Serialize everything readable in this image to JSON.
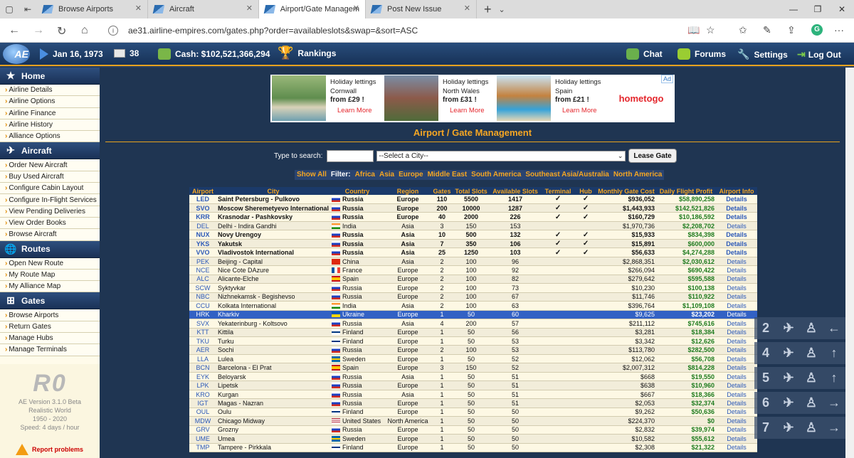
{
  "browser": {
    "tabs": [
      {
        "label": "Browse Airports"
      },
      {
        "label": "Aircraft"
      },
      {
        "label": "Airport/Gate Managem"
      },
      {
        "label": "Post New Issue"
      }
    ],
    "url": "ae31.airline-empires.com/gates.php?order=availableslots&swap=&sort=ASC"
  },
  "header": {
    "date": "Jan 16, 1973",
    "messages": "38",
    "cash": "Cash: $102,521,366,294",
    "rankings": "Rankings",
    "chat": "Chat",
    "forums": "Forums",
    "settings": "Settings",
    "logout": "Log Out",
    "logo": "AE"
  },
  "sidebar": {
    "sections": [
      {
        "title": "Home",
        "items": [
          "Airline Details",
          "Airline Options",
          "Airline Finance",
          "Airline History",
          "Alliance Options"
        ]
      },
      {
        "title": "Aircraft",
        "items": [
          "Order New Aircraft",
          "Buy Used Aircraft",
          "Configure Cabin Layout",
          "Configure In-Flight Services",
          "View Pending Deliveries",
          "View Order Books",
          "Browse Aircraft"
        ]
      },
      {
        "title": "Routes",
        "items": [
          "Open New Route",
          "My Route Map",
          "My Alliance Map"
        ]
      },
      {
        "title": "Gates",
        "items": [
          "Browse Airports",
          "Return Gates",
          "Manage Hubs",
          "Manage Terminals"
        ]
      }
    ],
    "footer": {
      "logo": "R0",
      "version": "AE Version 3.1.0 Beta",
      "world": "Realistic World",
      "years": "1950 - 2020",
      "speed": "Speed: 4 days / hour",
      "report": "Report problems"
    }
  },
  "ad": {
    "cards": [
      {
        "line1": "Holiday lettings",
        "line2": "Cornwall",
        "price": "from £29 !",
        "more": "Learn More"
      },
      {
        "line1": "Holiday lettings",
        "line2": "North Wales",
        "price": "from £31 !",
        "more": "Learn More"
      },
      {
        "line1": "Holiday lettings",
        "line2": "Spain",
        "price": "from £21 !",
        "more": "Learn More"
      }
    ],
    "brand": "hometogo",
    "tag": "Ad"
  },
  "page": {
    "title": "Airport / Gate Management",
    "search_label": "Type to search:",
    "city_select": "--Select a City--",
    "lease_button": "Lease Gate",
    "filter_show_all": "Show All",
    "filter_label": "Filter:",
    "filters": [
      "Africa",
      "Asia",
      "Europe",
      "Middle East",
      "South America",
      "Southeast Asia/Australia",
      "North America"
    ]
  },
  "table": {
    "headers": [
      "Airport",
      "City",
      "Country",
      "Region",
      "Gates",
      "Total Slots",
      "Available Slots",
      "Terminal",
      "Hub",
      "Monthly Gate Cost",
      "Daily Flight Profit",
      "Airport Info"
    ],
    "rows": [
      {
        "code": "LED",
        "city": "Saint Petersburg - Pulkovo",
        "country": "Russia",
        "flag": "ru",
        "region": "Europe",
        "gates": "110",
        "total": "5500",
        "avail": "1417",
        "terminal": "✓",
        "hub": "✓",
        "cost": "$936,052",
        "profit": "$58,890,258",
        "info": "Details",
        "bold": true
      },
      {
        "code": "SVO",
        "city": "Moscow Sheremetyevo International",
        "country": "Russia",
        "flag": "ru",
        "region": "Europe",
        "gates": "200",
        "total": "10000",
        "avail": "1287",
        "terminal": "✓",
        "hub": "✓",
        "cost": "$1,443,933",
        "profit": "$142,521,826",
        "info": "Details",
        "bold": true
      },
      {
        "code": "KRR",
        "city": "Krasnodar - Pashkovsky",
        "country": "Russia",
        "flag": "ru",
        "region": "Europe",
        "gates": "40",
        "total": "2000",
        "avail": "226",
        "terminal": "✓",
        "hub": "✓",
        "cost": "$160,729",
        "profit": "$10,186,592",
        "info": "Details",
        "bold": true
      },
      {
        "code": "DEL",
        "city": "Delhi - Indira Gandhi",
        "country": "India",
        "flag": "in",
        "region": "Asia",
        "gates": "3",
        "total": "150",
        "avail": "153",
        "terminal": "",
        "hub": "",
        "cost": "$1,970,736",
        "profit": "$2,208,702",
        "info": "Details"
      },
      {
        "code": "NUX",
        "city": "Novy Urengoy",
        "country": "Russia",
        "flag": "ru",
        "region": "Asia",
        "gates": "10",
        "total": "500",
        "avail": "132",
        "terminal": "✓",
        "hub": "✓",
        "cost": "$15,933",
        "profit": "$834,398",
        "info": "Details",
        "bold": true
      },
      {
        "code": "YKS",
        "city": "Yakutsk",
        "country": "Russia",
        "flag": "ru",
        "region": "Asia",
        "gates": "7",
        "total": "350",
        "avail": "106",
        "terminal": "✓",
        "hub": "✓",
        "cost": "$15,891",
        "profit": "$600,000",
        "info": "Details",
        "bold": true
      },
      {
        "code": "VVO",
        "city": "Vladivostok International",
        "country": "Russia",
        "flag": "ru",
        "region": "Asia",
        "gates": "25",
        "total": "1250",
        "avail": "103",
        "terminal": "✓",
        "hub": "✓",
        "cost": "$56,633",
        "profit": "$4,274,288",
        "info": "Details",
        "bold": true
      },
      {
        "code": "PEK",
        "city": "Beijing - Capital",
        "country": "China",
        "flag": "cn",
        "region": "Asia",
        "gates": "2",
        "total": "100",
        "avail": "96",
        "terminal": "",
        "hub": "",
        "cost": "$2,868,351",
        "profit": "$2,030,612",
        "info": "Details"
      },
      {
        "code": "NCE",
        "city": "Nice Cote DAzure",
        "country": "France",
        "flag": "fr",
        "region": "Europe",
        "gates": "2",
        "total": "100",
        "avail": "92",
        "terminal": "",
        "hub": "",
        "cost": "$266,094",
        "profit": "$690,422",
        "info": "Details"
      },
      {
        "code": "ALC",
        "city": "Alicante-Elche",
        "country": "Spain",
        "flag": "es",
        "region": "Europe",
        "gates": "2",
        "total": "100",
        "avail": "82",
        "terminal": "",
        "hub": "",
        "cost": "$279,642",
        "profit": "$595,588",
        "info": "Details"
      },
      {
        "code": "SCW",
        "city": "Syktyvkar",
        "country": "Russia",
        "flag": "ru",
        "region": "Europe",
        "gates": "2",
        "total": "100",
        "avail": "73",
        "terminal": "",
        "hub": "",
        "cost": "$10,230",
        "profit": "$100,138",
        "info": "Details"
      },
      {
        "code": "NBC",
        "city": "Nizhnekamsk - Begishevso",
        "country": "Russia",
        "flag": "ru",
        "region": "Europe",
        "gates": "2",
        "total": "100",
        "avail": "67",
        "terminal": "",
        "hub": "",
        "cost": "$11,746",
        "profit": "$110,922",
        "info": "Details"
      },
      {
        "code": "CCU",
        "city": "Kolkata International",
        "country": "India",
        "flag": "in",
        "region": "Asia",
        "gates": "2",
        "total": "100",
        "avail": "63",
        "terminal": "",
        "hub": "",
        "cost": "$396,764",
        "profit": "$1,109,108",
        "info": "Details"
      },
      {
        "code": "HRK",
        "city": "Kharkiv",
        "country": "Ukraine",
        "flag": "ua",
        "region": "Europe",
        "gates": "1",
        "total": "50",
        "avail": "60",
        "terminal": "",
        "hub": "",
        "cost": "$9,625",
        "profit": "$23,202",
        "info": "Details",
        "selected": true
      },
      {
        "code": "SVX",
        "city": "Yekaterinburg - Koltsovo",
        "country": "Russia",
        "flag": "ru",
        "region": "Asia",
        "gates": "4",
        "total": "200",
        "avail": "57",
        "terminal": "",
        "hub": "",
        "cost": "$211,112",
        "profit": "$745,616",
        "info": "Details"
      },
      {
        "code": "KTT",
        "city": "Kittila",
        "country": "Finland",
        "flag": "fi",
        "region": "Europe",
        "gates": "1",
        "total": "50",
        "avail": "56",
        "terminal": "",
        "hub": "",
        "cost": "$3,281",
        "profit": "$18,384",
        "info": "Details"
      },
      {
        "code": "TKU",
        "city": "Turku",
        "country": "Finland",
        "flag": "fi",
        "region": "Europe",
        "gates": "1",
        "total": "50",
        "avail": "53",
        "terminal": "",
        "hub": "",
        "cost": "$3,342",
        "profit": "$12,626",
        "info": "Details"
      },
      {
        "code": "AER",
        "city": "Sochi",
        "country": "Russia",
        "flag": "ru",
        "region": "Europe",
        "gates": "2",
        "total": "100",
        "avail": "53",
        "terminal": "",
        "hub": "",
        "cost": "$113,780",
        "profit": "$282,500",
        "info": "Details"
      },
      {
        "code": "LLA",
        "city": "Lulea",
        "country": "Sweden",
        "flag": "se",
        "region": "Europe",
        "gates": "1",
        "total": "50",
        "avail": "52",
        "terminal": "",
        "hub": "",
        "cost": "$12,062",
        "profit": "$56,708",
        "info": "Details"
      },
      {
        "code": "BCN",
        "city": "Barcelona - El Prat",
        "country": "Spain",
        "flag": "es",
        "region": "Europe",
        "gates": "3",
        "total": "150",
        "avail": "52",
        "terminal": "",
        "hub": "",
        "cost": "$2,007,312",
        "profit": "$814,228",
        "info": "Details"
      },
      {
        "code": "EYK",
        "city": "Beloyarsk",
        "country": "Russia",
        "flag": "ru",
        "region": "Asia",
        "gates": "1",
        "total": "50",
        "avail": "51",
        "terminal": "",
        "hub": "",
        "cost": "$668",
        "profit": "$19,550",
        "info": "Details"
      },
      {
        "code": "LPK",
        "city": "Lipetsk",
        "country": "Russia",
        "flag": "ru",
        "region": "Europe",
        "gates": "1",
        "total": "50",
        "avail": "51",
        "terminal": "",
        "hub": "",
        "cost": "$638",
        "profit": "$10,960",
        "info": "Details"
      },
      {
        "code": "KRO",
        "city": "Kurgan",
        "country": "Russia",
        "flag": "ru",
        "region": "Asia",
        "gates": "1",
        "total": "50",
        "avail": "51",
        "terminal": "",
        "hub": "",
        "cost": "$667",
        "profit": "$18,366",
        "info": "Details"
      },
      {
        "code": "IGT",
        "city": "Magas - Nazran",
        "country": "Russia",
        "flag": "ru",
        "region": "Europe",
        "gates": "1",
        "total": "50",
        "avail": "51",
        "terminal": "",
        "hub": "",
        "cost": "$2,053",
        "profit": "$32,374",
        "info": "Details"
      },
      {
        "code": "OUL",
        "city": "Oulu",
        "country": "Finland",
        "flag": "fi",
        "region": "Europe",
        "gates": "1",
        "total": "50",
        "avail": "50",
        "terminal": "",
        "hub": "",
        "cost": "$9,262",
        "profit": "$50,636",
        "info": "Details"
      },
      {
        "code": "MDW",
        "city": "Chicago Midway",
        "country": "United States",
        "flag": "us",
        "region": "North America",
        "gates": "1",
        "total": "50",
        "avail": "50",
        "terminal": "",
        "hub": "",
        "cost": "$224,370",
        "profit": "$0",
        "info": "Details"
      },
      {
        "code": "GRV",
        "city": "Grozny",
        "country": "Russia",
        "flag": "ru",
        "region": "Europe",
        "gates": "1",
        "total": "50",
        "avail": "50",
        "terminal": "",
        "hub": "",
        "cost": "$2,832",
        "profit": "$39,974",
        "info": "Details"
      },
      {
        "code": "UME",
        "city": "Umea",
        "country": "Sweden",
        "flag": "se",
        "region": "Europe",
        "gates": "1",
        "total": "50",
        "avail": "50",
        "terminal": "",
        "hub": "",
        "cost": "$10,582",
        "profit": "$55,612",
        "info": "Details"
      },
      {
        "code": "TMP",
        "city": "Tampere - Pirkkala",
        "country": "Finland",
        "flag": "fi",
        "region": "Europe",
        "gates": "1",
        "total": "50",
        "avail": "50",
        "terminal": "",
        "hub": "",
        "cost": "$2,308",
        "profit": "$21,322",
        "info": "Details"
      }
    ]
  },
  "overlay": {
    "rows": [
      {
        "num": "2"
      },
      {
        "num": "4"
      },
      {
        "num": "5"
      },
      {
        "num": "6"
      },
      {
        "num": "7"
      }
    ]
  }
}
